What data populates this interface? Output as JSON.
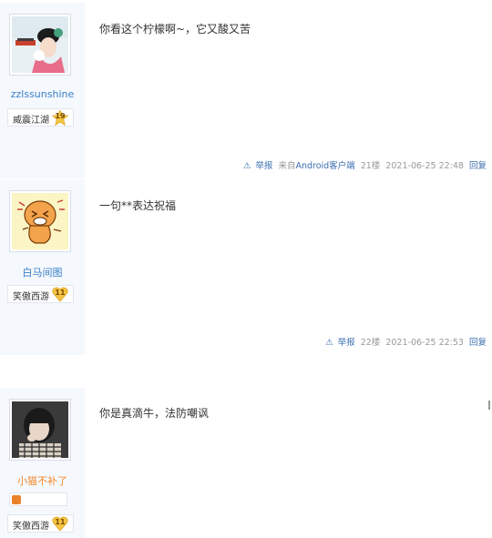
{
  "posts": [
    {
      "username": "zzlssunshine",
      "rank_name": "威震江湖",
      "rank_level": "19",
      "content": "你看这个柠檬啊~，它又酸又苦",
      "report": "举报",
      "client_prefix": "来自",
      "client_name": "Android客户端",
      "floor": "21楼",
      "time": "2021-06-25 22:48",
      "reply": "回复"
    },
    {
      "username": "白马间图",
      "rank_name": "笑傲西游",
      "rank_level": "11",
      "content": "一句**表达祝福",
      "report": "举报",
      "floor": "22楼",
      "time": "2021-06-25 22:53",
      "reply": "回复"
    },
    {
      "username": "小猫不补了",
      "rank_name": "笑傲西游",
      "rank_level": "11",
      "content": "你是真滴牛，法防嘲讽"
    }
  ],
  "colors": {
    "sidebar": "#f5f8fd",
    "link": "#3a6fb0",
    "badge_gold": "#f4c542",
    "orange_name": "#f28a2b"
  },
  "icons": [
    "warning-triangle-icon",
    "rank-star-badge-icon",
    "rank-heart-badge-icon",
    "medal-icon"
  ]
}
